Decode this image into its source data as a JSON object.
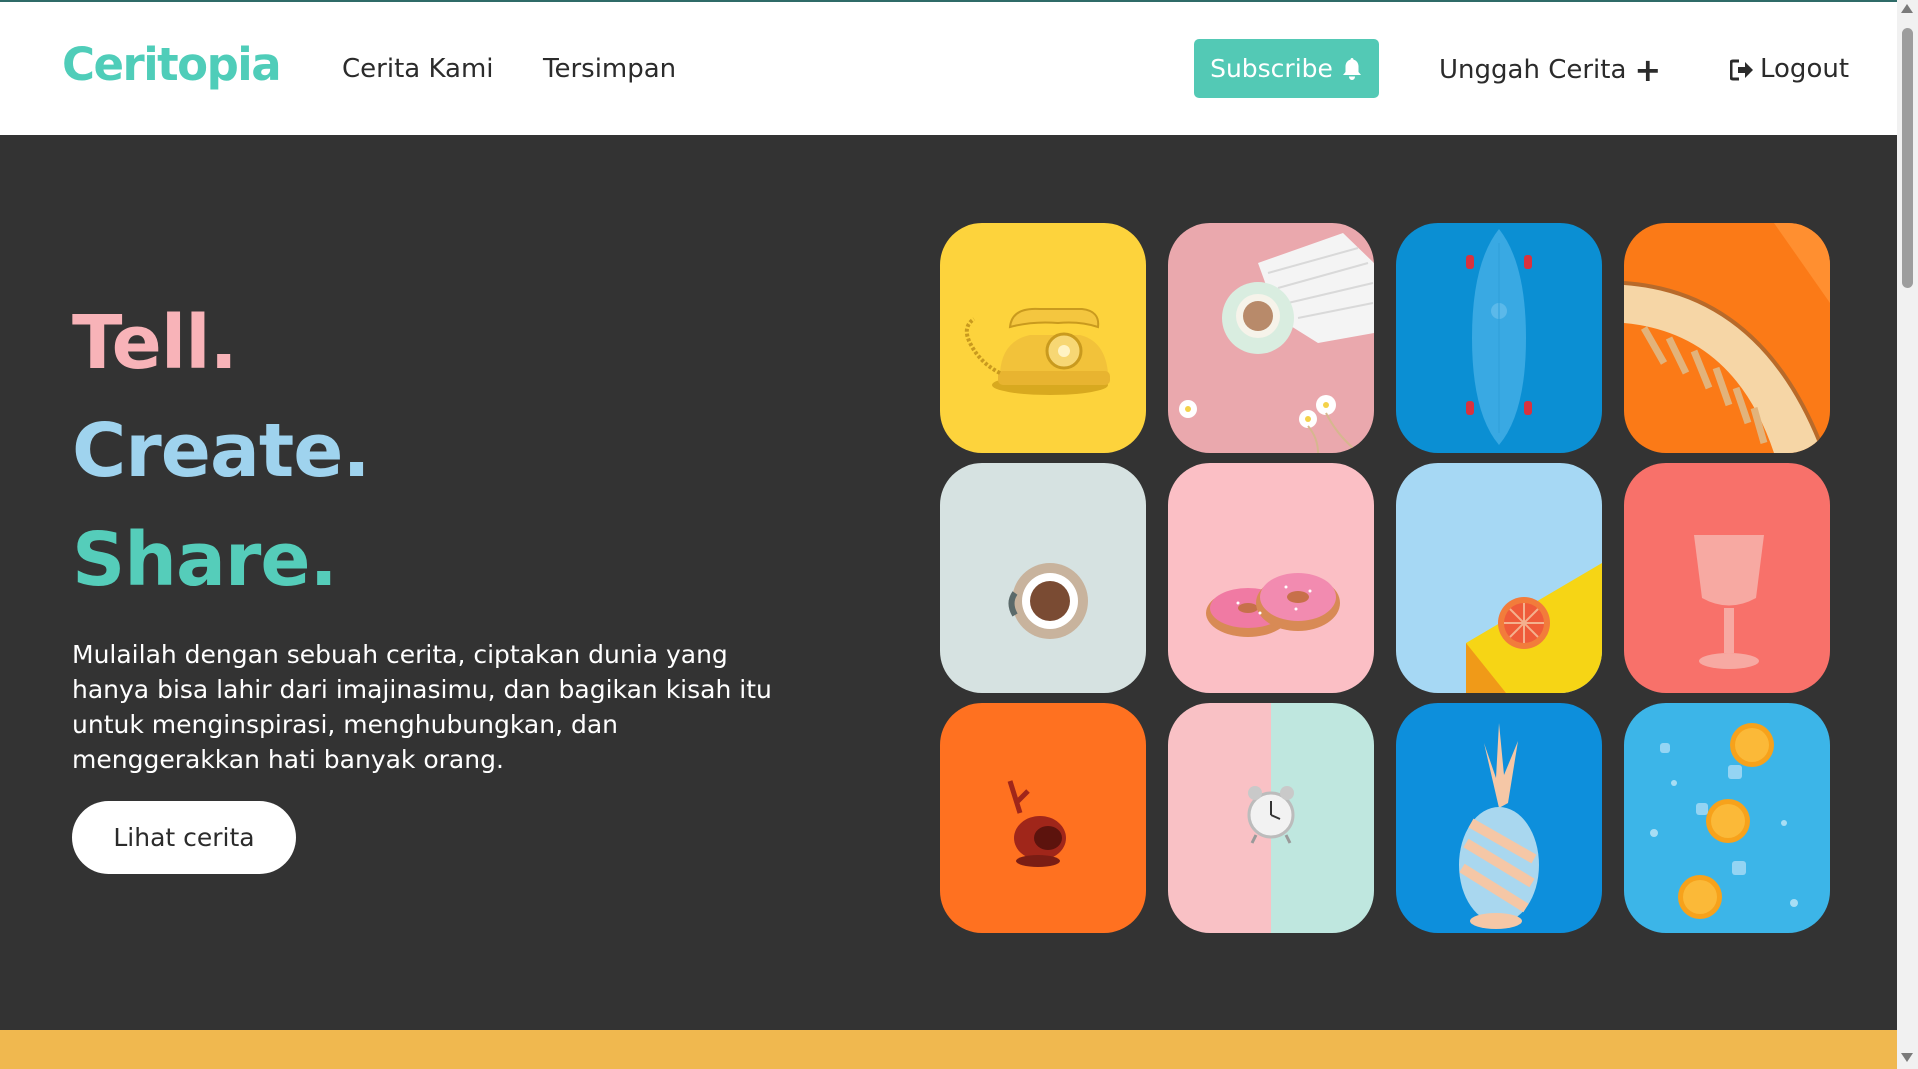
{
  "brand": {
    "logo_text": "Ceritopia",
    "accent_color": "#53c9b5"
  },
  "nav": {
    "links": [
      "Cerita Kami",
      "Tersimpan"
    ],
    "subscribe_label": "Subscribe",
    "subscribe_icon": "bell-icon",
    "upload_label": "Unggah Cerita",
    "upload_icon": "plus-icon",
    "logout_label": "Logout",
    "logout_icon": "sign-out-icon"
  },
  "hero": {
    "headline": [
      "Tell.",
      "Create.",
      "Share."
    ],
    "headline_colors": [
      "#f8b3b8",
      "#9fd3ee",
      "#55cdba"
    ],
    "description": "Mulailah dengan sebuah cerita, ciptakan dunia yang hanya bisa lahir dari imajinasimu, dan bagikan kisah itu untuk menginspirasi, menghubungkan, dan menggerakkan hati banyak orang.",
    "cta_label": "Lihat cerita",
    "background_color": "#333333"
  },
  "gallery": [
    {
      "subject": "yellow rotary telephone",
      "bg": "#fdd33c"
    },
    {
      "subject": "coffee cup with napkin and flowers",
      "bg": "#eaa8ad"
    },
    {
      "subject": "blue skateboard",
      "bg": "#0b8fd3"
    },
    {
      "subject": "orange architecture curve",
      "bg": "#fb7a17"
    },
    {
      "subject": "coffee cup top view",
      "bg": "#d6e2e1"
    },
    {
      "subject": "pink donuts",
      "bg": "#fbbfc5"
    },
    {
      "subject": "grapefruit on yellow block",
      "bg": "#a6d8f4"
    },
    {
      "subject": "pink goblet",
      "bg": "#f8716a"
    },
    {
      "subject": "red toy trumpet",
      "bg": "#ff7120"
    },
    {
      "subject": "alarm clock on split background",
      "bg": "#f9c1c5"
    },
    {
      "subject": "pastel pineapple",
      "bg": "#0d8fdc"
    },
    {
      "subject": "orange slices on blue water",
      "bg": "#3cb5e8"
    }
  ],
  "footer_strip_color": "#f0b84f"
}
